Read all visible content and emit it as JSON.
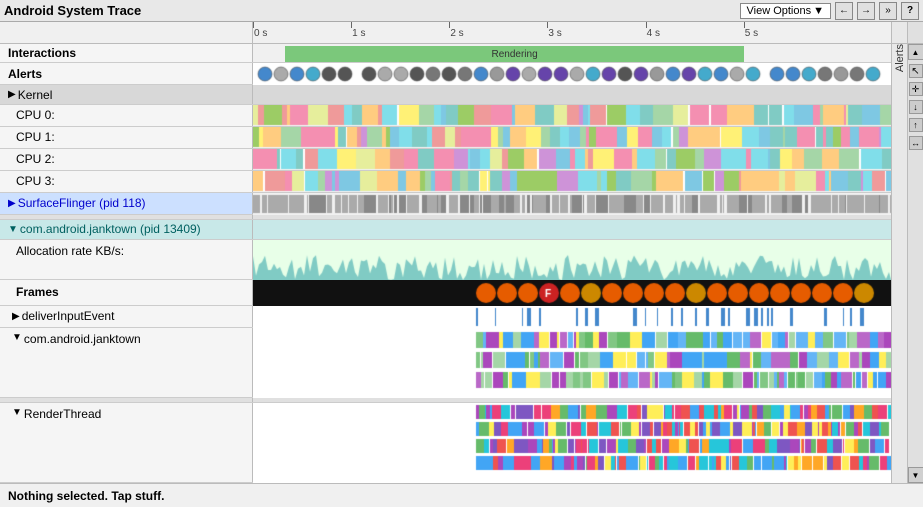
{
  "titleBar": {
    "title": "Android System Trace",
    "viewOptionsLabel": "View Options",
    "navBack": "←",
    "navForward": "→",
    "navExpand": "»",
    "helpLabel": "?"
  },
  "ruler": {
    "ticks": [
      {
        "label": "0 s",
        "pct": 0
      },
      {
        "label": "1 s",
        "pct": 15.38
      },
      {
        "label": "2 s",
        "pct": 30.77
      },
      {
        "label": "3 s",
        "pct": 46.15
      },
      {
        "label": "4 s",
        "pct": 61.54
      },
      {
        "label": "5 s",
        "pct": 76.92
      }
    ]
  },
  "rows": {
    "interactions": {
      "label": "Interactions",
      "renderingLabel": "Rendering"
    },
    "alerts": {
      "label": "Alerts"
    },
    "kernel": {
      "label": "Kernel",
      "expanded": false
    },
    "cpu0": {
      "label": "CPU 0:"
    },
    "cpu1": {
      "label": "CPU 1:"
    },
    "cpu2": {
      "label": "CPU 2:"
    },
    "cpu3": {
      "label": "CPU 3:"
    },
    "surfaceFlinger": {
      "label": "SurfaceFlinger (pid 118)"
    },
    "janktown": {
      "label": "com.android.janktown (pid 13409)"
    },
    "allocationRate": {
      "label": "Allocation rate KB/s:"
    },
    "frames": {
      "label": "Frames"
    },
    "deliverInputEvent": {
      "label": "deliverInputEvent"
    },
    "comAndroidJanktown": {
      "label": "com.android.janktown"
    },
    "renderThread": {
      "label": "RenderThread"
    }
  },
  "statusBar": {
    "message": "Nothing selected. Tap stuff."
  },
  "sidebar": {
    "label": "Alerts"
  },
  "colors": {
    "green": "#7bc87b",
    "teal": "#00897b",
    "blue": "#4285f4",
    "purple": "#9c27b0",
    "orange": "#ff6d00",
    "red": "#d32f2f",
    "yellow": "#fdd835",
    "pink": "#e91e63",
    "lightBlue": "#29b6f6",
    "gray": "#9e9e9e"
  }
}
